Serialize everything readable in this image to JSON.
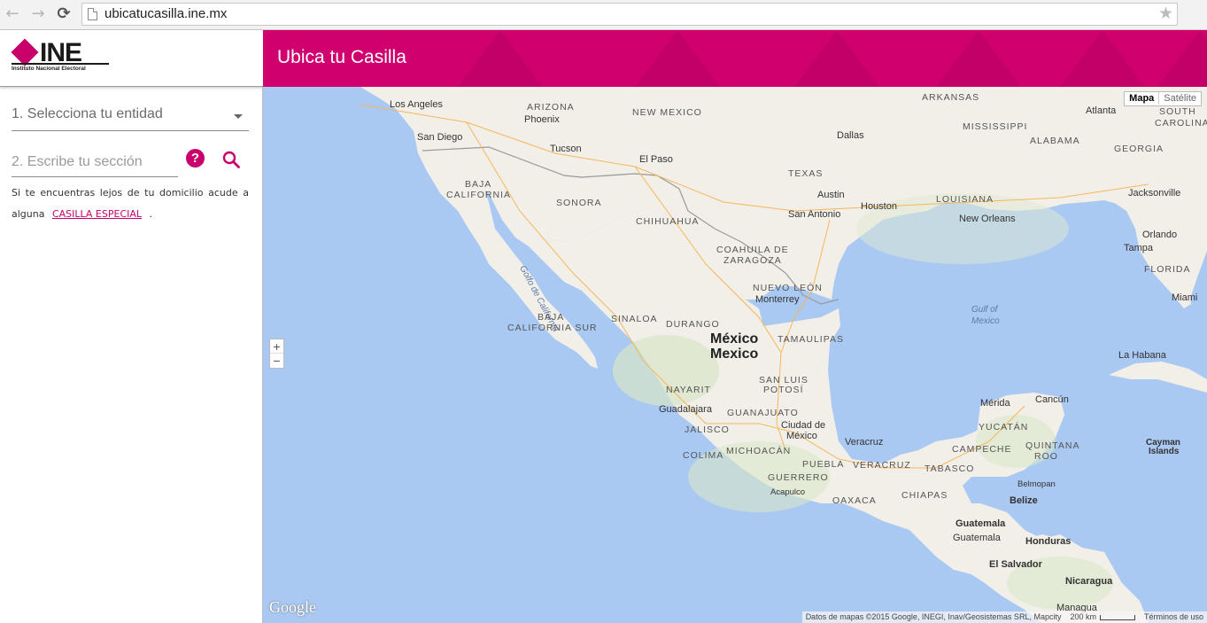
{
  "browser": {
    "url": "ubicatucasilla.ine.mx"
  },
  "logo": {
    "name": "INE",
    "subtitle": "Instituto Nacional Electoral"
  },
  "header": {
    "title": "Ubica tu Casilla"
  },
  "form": {
    "entity_select_label": "1. Selecciona tu entidad",
    "section_placeholder": "2. Escribe tu sección",
    "help_label": "?",
    "notice_text": "Si te encuentras lejos de tu domicilio acude a alguna",
    "notice_link": "CASILLA ESPECIAL",
    "notice_end": "."
  },
  "map": {
    "type_active": "Mapa",
    "type_inactive": "Satélite",
    "zoom_in": "+",
    "zoom_out": "−",
    "google": "Google",
    "attribution": "Datos de mapas ©2015 Google, INEGI, Inav/Geosistemas SRL, Mapcity",
    "scale": "200 km",
    "terms": "Términos de uso",
    "labels": {
      "los_angeles": "Los Angeles",
      "san_diego": "San Diego",
      "arizona": "ARIZONA",
      "phoenix": "Phoenix",
      "tucson": "Tucson",
      "new_mexico": "NEW MEXICO",
      "el_paso": "El Paso",
      "arkansas": "ARKANSAS",
      "mississippi": "MISSISSIPPI",
      "alabama": "ALABAMA",
      "georgia": "GEORGIA",
      "atlanta": "Atlanta",
      "south": "SOUTH",
      "carolina": "CAROLINA",
      "dallas": "Dallas",
      "texas": "TEXAS",
      "austin": "Austin",
      "san_antonio": "San Antonio",
      "houston": "Houston",
      "louisiana": "LOUISIANA",
      "new_orleans": "New Orleans",
      "jacksonville": "Jacksonville",
      "orlando": "Orlando",
      "tampa": "Tampa",
      "florida": "FLORIDA",
      "miami": "Miami",
      "baja_california_1": "BAJA",
      "baja_california_2": "CALIFORNIA",
      "sonora": "SONORA",
      "chihuahua": "CHIHUAHUA",
      "coahuila_1": "COAHUILA DE",
      "coahuila_2": "ZARAGOZA",
      "nuevo_leon": "NUEVO LEÓN",
      "monterrey": "Monterrey",
      "golfo_california": "Golfo de California",
      "gulf_of_mexico_1": "Gulf of",
      "gulf_of_mexico_2": "Mexico",
      "bcs_1": "BAJA",
      "bcs_2": "CALIFORNIA SUR",
      "sinaloa": "SINALOA",
      "durango": "DURANGO",
      "mexico_1": "México",
      "mexico_2": "Mexico",
      "tamaulipas": "TAMAULIPAS",
      "la_habana": "La Habana",
      "nayarit": "NAYARIT",
      "san_luis_1": "SAN LUIS",
      "san_luis_2": "POTOSÍ",
      "merida": "Mérida",
      "cancun": "Cancún",
      "guadalajara": "Guadalajara",
      "guanajuato": "GUANAJUATO",
      "yucatan": "YUCATÁN",
      "jalisco": "JALISCO",
      "cdmx_1": "Ciudad de",
      "cdmx_2": "México",
      "veracruz_city": "Veracruz",
      "campeche": "CAMPECHE",
      "quintana_1": "QUINTANA",
      "quintana_2": "ROO",
      "cayman_1": "Cayman",
      "cayman_2": "Islands",
      "colima": "COLIMA",
      "michoacan": "MICHOACÁN",
      "puebla": "PUEBLA",
      "veracruz": "VERACRUZ",
      "tabasco": "TABASCO",
      "guerrero": "GUERRERO",
      "acapulco": "Acapulco",
      "belmopan": "Belmopan",
      "oaxaca": "OAXACA",
      "chiapas": "CHIAPAS",
      "belize": "Belize",
      "guatemala_country": "Guatemala",
      "guatemala_city": "Guatemala",
      "honduras": "Honduras",
      "el_salvador": "El Salvador",
      "nicaragua": "Nicaragua",
      "managua": "Managua"
    }
  },
  "colors": {
    "brand": "#c9006b",
    "header": "#d0006f",
    "water": "#a9c8f2",
    "land": "#f2efe9"
  }
}
